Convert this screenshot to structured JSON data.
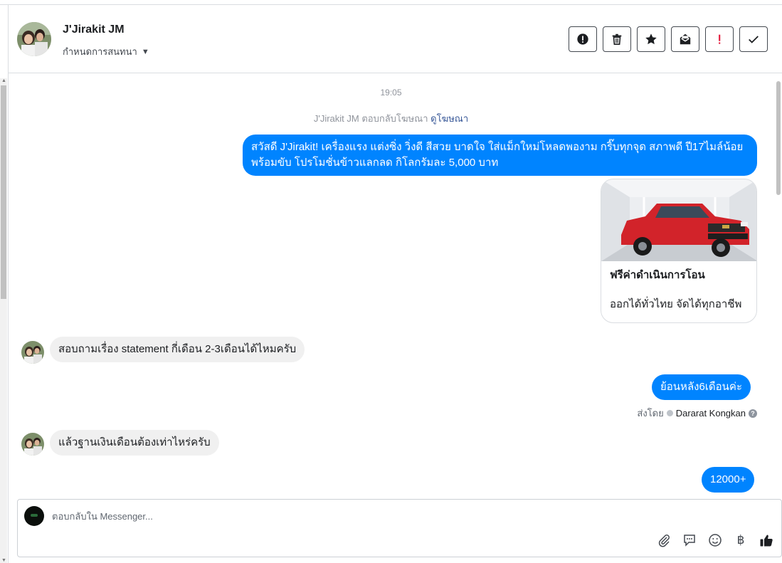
{
  "header": {
    "contact_name": "J'Jirakit JM",
    "assign_label": "กำหนดการสนทนา",
    "actions": [
      {
        "name": "report-icon",
        "label": "Report"
      },
      {
        "name": "trash-icon",
        "label": "Delete"
      },
      {
        "name": "star-icon",
        "label": "Star"
      },
      {
        "name": "mark-unread-icon",
        "label": "Mark unread"
      },
      {
        "name": "follow-up-icon",
        "label": "Follow up"
      },
      {
        "name": "check-icon",
        "label": "Done"
      }
    ]
  },
  "chat": {
    "timestamp": "19:05",
    "ad_reply_text": "J'Jirakit JM ตอบกลับโฆษณา",
    "ad_reply_link": "ดูโฆษณา",
    "messages": [
      {
        "direction": "out",
        "text": "สวัสดี J'Jirakit! เครื่องแรง แต่งซิ่ง วิ่งดี สีสวย บาดใจ ใส่แม็กใหม่โหลดพองาม กริ๊บทุกจุด สภาพดี ปี17ไมล์น้อย พร้อมขับ โปรโมชั่นข้าวแลกลด กิโลกรัมละ 5,000 บาท"
      },
      {
        "direction": "out",
        "type": "card",
        "title": "ฟรีค่าดำเนินการโอน",
        "subtitle": "ออกได้ทั่วไทย จัดได้ทุกอาชีพ",
        "image": "red-pickup-truck"
      },
      {
        "direction": "in",
        "text": "สอบถามเรื่อง statement กี่เดือน 2-3เดือนได้ไหมครับ"
      },
      {
        "direction": "out",
        "text": "ย้อนหลัง6เดือนค่ะ"
      },
      {
        "direction": "in",
        "text": "แล้วฐานเงินเดือนต้องเท่าไหร่ครับ"
      },
      {
        "direction": "out",
        "text": "12000+"
      }
    ],
    "sent_by_label": "ส่งโดย",
    "sent_by_agent": "Dararat Kongkan"
  },
  "composer": {
    "placeholder": "ตอบกลับใน Messenger...",
    "tools": [
      "paperclip-icon",
      "saved-reply-icon",
      "emoji-icon",
      "baht-icon",
      "thumbs-up-icon"
    ]
  },
  "colors": {
    "outgoing_bubble": "#0084ff",
    "incoming_bubble": "#f0f0f0",
    "link": "#385898"
  }
}
